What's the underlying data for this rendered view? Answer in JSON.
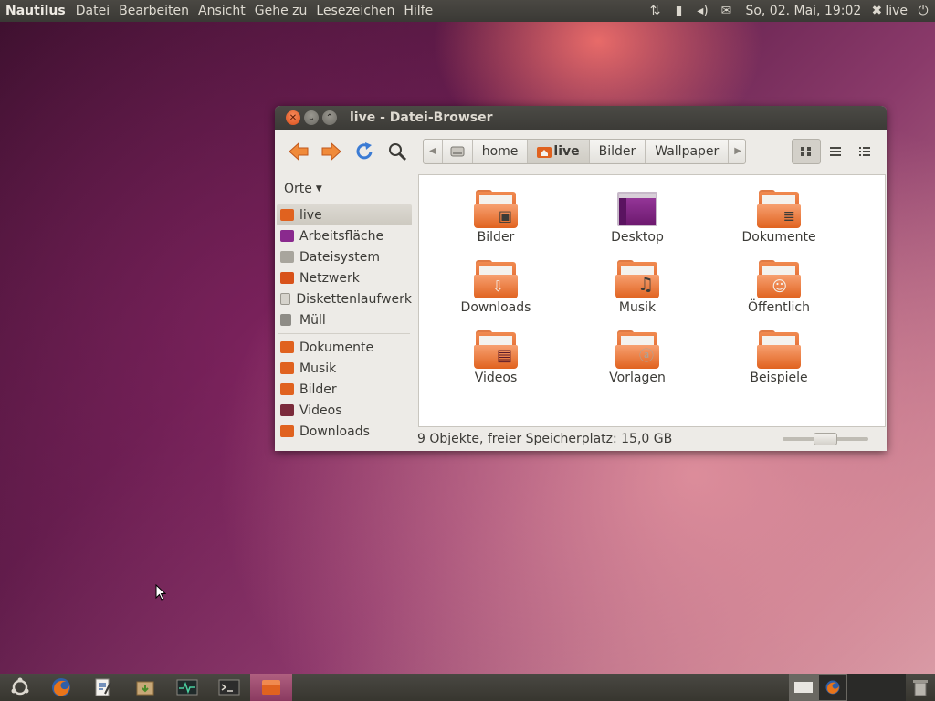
{
  "top_panel": {
    "app_name": "Nautilus",
    "menus": [
      {
        "pre": "",
        "key": "D",
        "post": "atei"
      },
      {
        "pre": "",
        "key": "B",
        "post": "earbeiten"
      },
      {
        "pre": "",
        "key": "A",
        "post": "nsicht"
      },
      {
        "pre": "",
        "key": "G",
        "post": "ehe zu"
      },
      {
        "pre": "",
        "key": "L",
        "post": "esezeichen"
      },
      {
        "pre": "",
        "key": "H",
        "post": "ilfe"
      }
    ],
    "clock": "So, 02. Mai, 19:02",
    "user": "live"
  },
  "window": {
    "title": "live - Datei-Browser",
    "path": [
      "home",
      "live",
      "Bilder",
      "Wallpaper"
    ],
    "active_crumb": "live"
  },
  "sidebar": {
    "header": "Orte",
    "places": [
      {
        "label": "live",
        "color": "#e0621f"
      },
      {
        "label": "Arbeitsfläche",
        "color": "#8a2a8e"
      },
      {
        "label": "Dateisystem",
        "color": "#a8a59d"
      },
      {
        "label": "Netzwerk",
        "color": "#d8521a"
      },
      {
        "label": "Diskettenlaufwerk",
        "color": "#d6d3cc"
      },
      {
        "label": "Müll",
        "color": "#8e8c86"
      }
    ],
    "bookmarks": [
      {
        "label": "Dokumente",
        "color": "#e0621f"
      },
      {
        "label": "Musik",
        "color": "#e0621f"
      },
      {
        "label": "Bilder",
        "color": "#e0621f"
      },
      {
        "label": "Videos",
        "color": "#7a2a3a"
      },
      {
        "label": "Downloads",
        "color": "#e0621f"
      }
    ]
  },
  "files": [
    {
      "label": "Bilder",
      "emblem": "▣"
    },
    {
      "label": "Desktop",
      "emblem": ""
    },
    {
      "label": "Dokumente",
      "emblem": "≣"
    },
    {
      "label": "Downloads",
      "emblem": "⇩"
    },
    {
      "label": "Musik",
      "emblem": "♫"
    },
    {
      "label": "Öffentlich",
      "emblem": "☺"
    },
    {
      "label": "Videos",
      "emblem": "▤"
    },
    {
      "label": "Vorlagen",
      "emblem": "ⓐ"
    },
    {
      "label": "Beispiele",
      "emblem": ""
    }
  ],
  "statusbar": {
    "text": "9 Objekte, freier Speicherplatz: 15,0 GB"
  }
}
